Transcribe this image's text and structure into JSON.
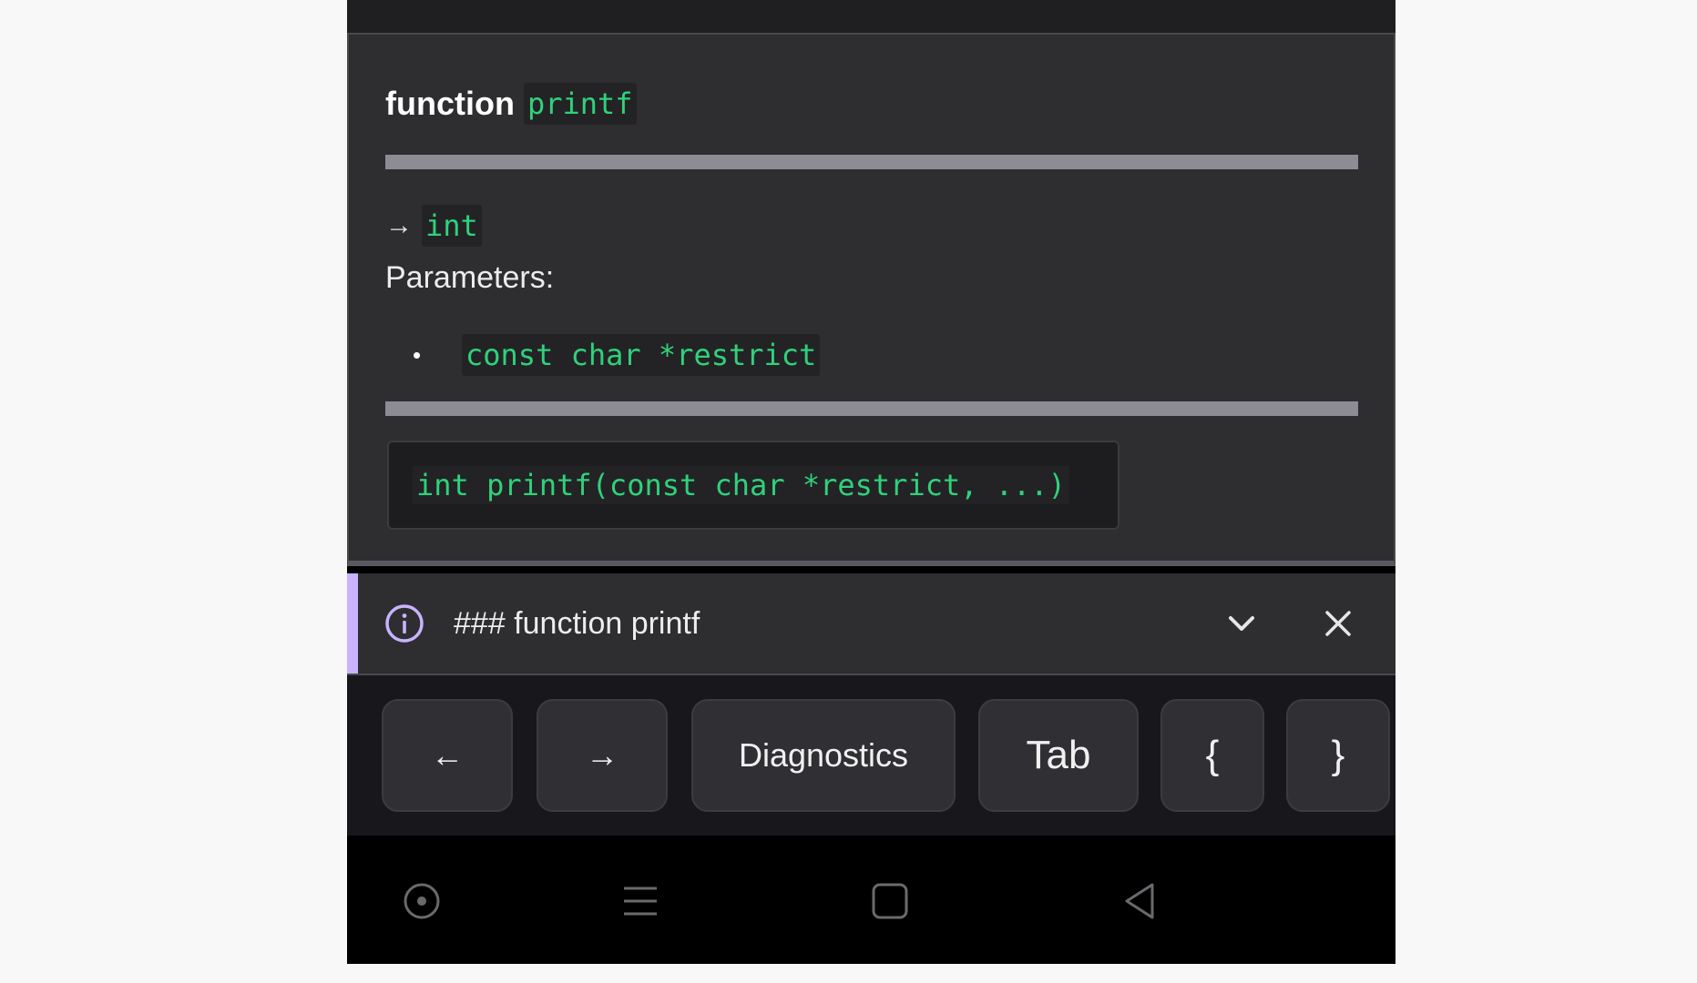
{
  "hover": {
    "keyword": "function",
    "name": "printf",
    "return_arrow": "→",
    "return_type": "int",
    "params_label": "Parameters:",
    "bullet": "•",
    "params": [
      "const char *restrict"
    ],
    "signature": "int printf(const char *restrict, ...)"
  },
  "info_bar": {
    "text": "### function printf",
    "icon": "info-icon",
    "accent_color": "#c9b3ff"
  },
  "keys": {
    "left": "←",
    "right": "→",
    "diagnostics": "Diagnostics",
    "tab": "Tab",
    "left_brace": "{",
    "right_brace": "}"
  },
  "colors": {
    "code_green": "#2fd27a",
    "panel_bg": "#2e2e31",
    "key_bg": "#302f34"
  }
}
